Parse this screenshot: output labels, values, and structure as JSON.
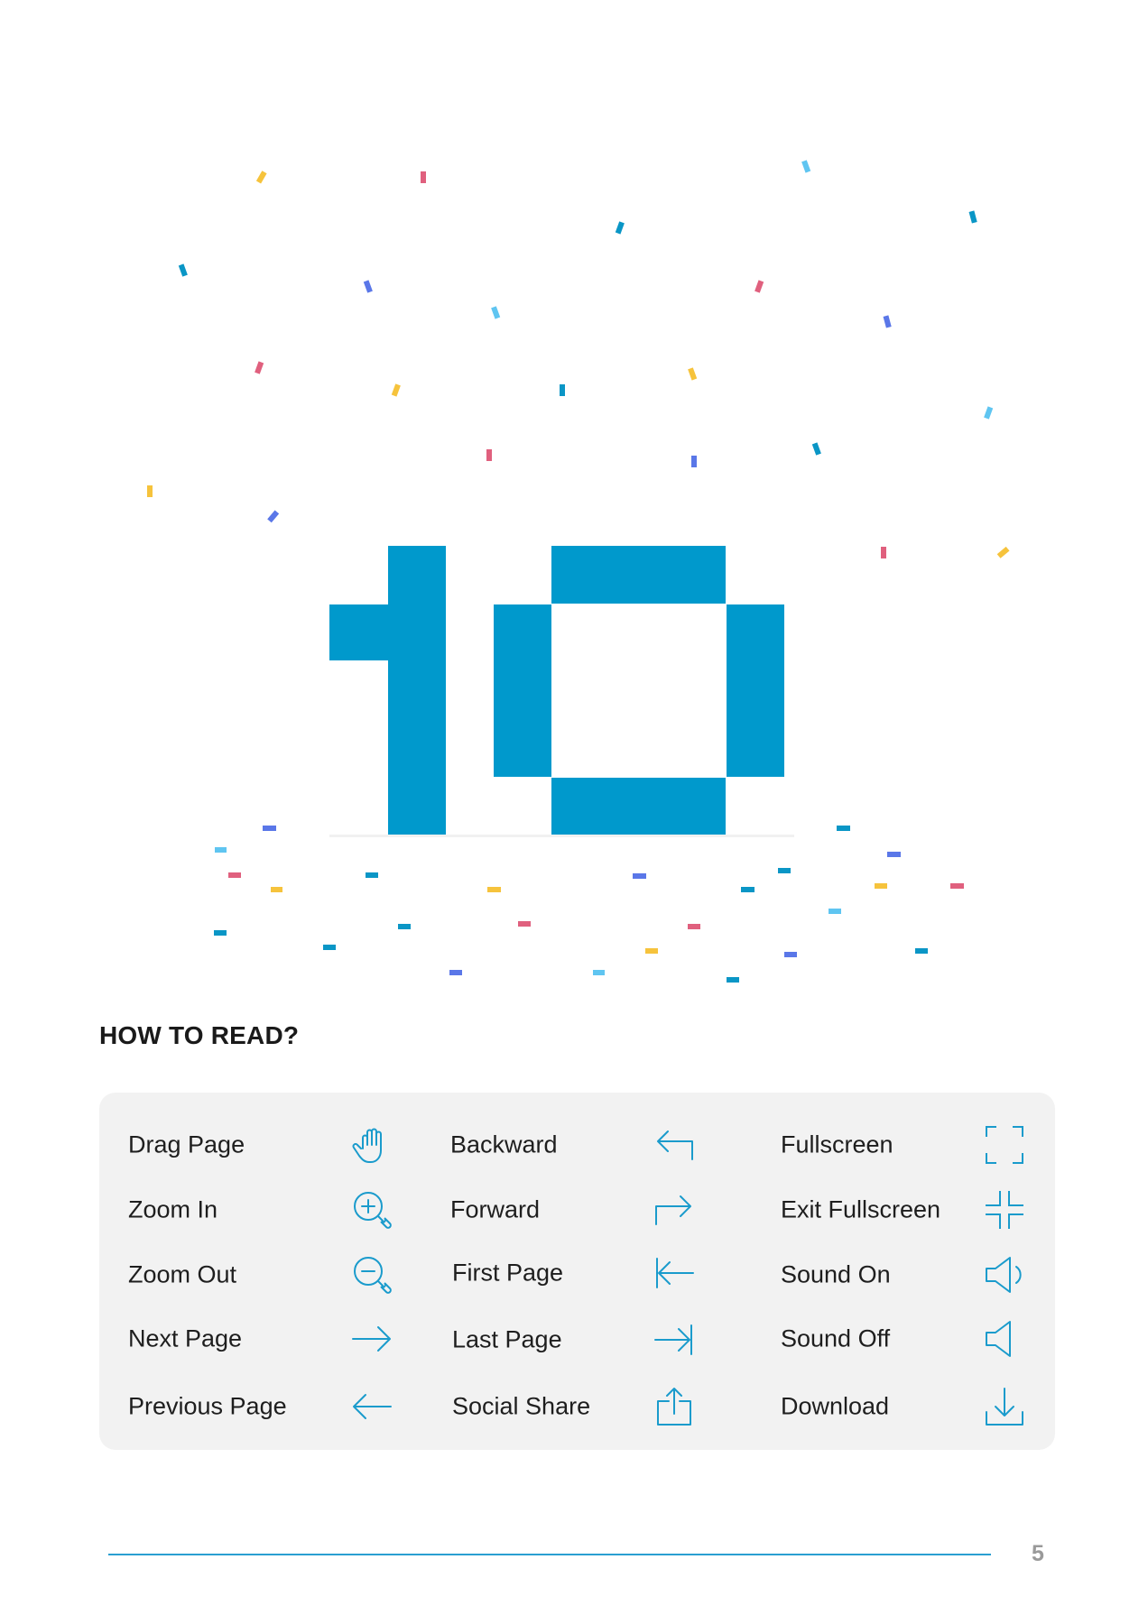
{
  "section": {
    "title": "HOW TO READ?"
  },
  "accent_color": "#0099cc",
  "icon_color": "#1a9bcc",
  "controls": {
    "columns": [
      [
        {
          "label": "Drag Page",
          "icon": "hand-icon"
        },
        {
          "label": "Zoom In",
          "icon": "zoom-in-icon"
        },
        {
          "label": "Zoom Out",
          "icon": "zoom-out-icon"
        },
        {
          "label": "Next Page",
          "icon": "arrow-right-icon"
        },
        {
          "label": "Previous Page",
          "icon": "arrow-left-icon"
        }
      ],
      [
        {
          "label": "Backward",
          "icon": "backward-icon"
        },
        {
          "label": "Forward",
          "icon": "forward-icon"
        },
        {
          "label": "First Page",
          "icon": "first-page-icon"
        },
        {
          "label": "Last Page",
          "icon": "last-page-icon"
        },
        {
          "label": "Social Share",
          "icon": "share-icon"
        }
      ],
      [
        {
          "label": "Fullscreen",
          "icon": "fullscreen-icon"
        },
        {
          "label": "Exit Fullscreen",
          "icon": "exit-fullscreen-icon"
        },
        {
          "label": "Sound On",
          "icon": "sound-on-icon"
        },
        {
          "label": "Sound Off",
          "icon": "sound-off-icon"
        },
        {
          "label": "Download",
          "icon": "download-icon"
        }
      ]
    ]
  },
  "footer": {
    "page_number": "5"
  }
}
